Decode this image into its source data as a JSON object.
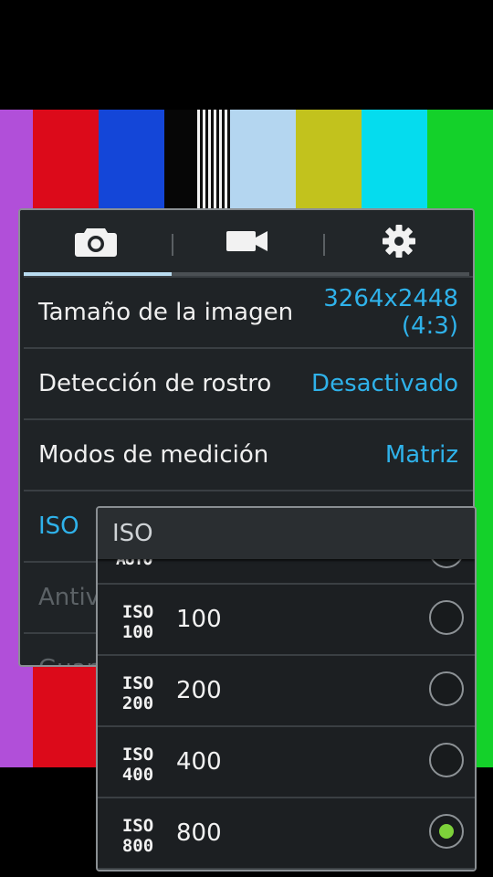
{
  "colors": {
    "accent_blue": "#2fb2ea",
    "tab_indicator": "#b9dcf0",
    "radio_selected": "#7dd13a",
    "panel_bg": "#1f2326"
  },
  "tabs": [
    {
      "icon": "camera-icon"
    },
    {
      "icon": "video-camera-icon"
    },
    {
      "icon": "gear-icon"
    }
  ],
  "settings": {
    "image_size": {
      "label": "Tamaño de la imagen",
      "value": "3264x2448\n(4:3)"
    },
    "face_detection": {
      "label": "Detección de rostro",
      "value": "Desactivado"
    },
    "metering": {
      "label": "Modos de medición",
      "value": "Matriz"
    },
    "iso": {
      "label": "ISO"
    },
    "anti": {
      "label": "Antiv"
    },
    "save": {
      "label": "Guar"
    }
  },
  "iso_dropdown": {
    "title": "ISO",
    "partial_icon_text": "AUTO",
    "options": [
      {
        "label": "100",
        "icon_top": "ISO",
        "icon_bottom": "100",
        "selected": false
      },
      {
        "label": "200",
        "icon_top": "ISO",
        "icon_bottom": "200",
        "selected": false
      },
      {
        "label": "400",
        "icon_top": "ISO",
        "icon_bottom": "400",
        "selected": false
      },
      {
        "label": "800",
        "icon_top": "ISO",
        "icon_bottom": "800",
        "selected": true
      }
    ]
  }
}
